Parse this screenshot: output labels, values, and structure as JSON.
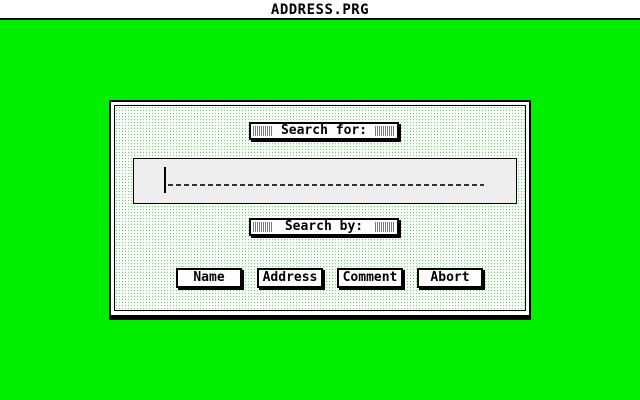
{
  "window": {
    "title": "ADDRESS.PRG"
  },
  "dialog": {
    "search_for_label": "Search for:",
    "search_value": "",
    "search_by_label": "Search by:",
    "buttons": {
      "name": "Name",
      "address": "Address",
      "comment": "Comment",
      "abort": "Abort"
    }
  },
  "colors": {
    "desktop": "#00ee00",
    "dialog_background": "#ffffff",
    "label_hatch": "#ff4040"
  }
}
